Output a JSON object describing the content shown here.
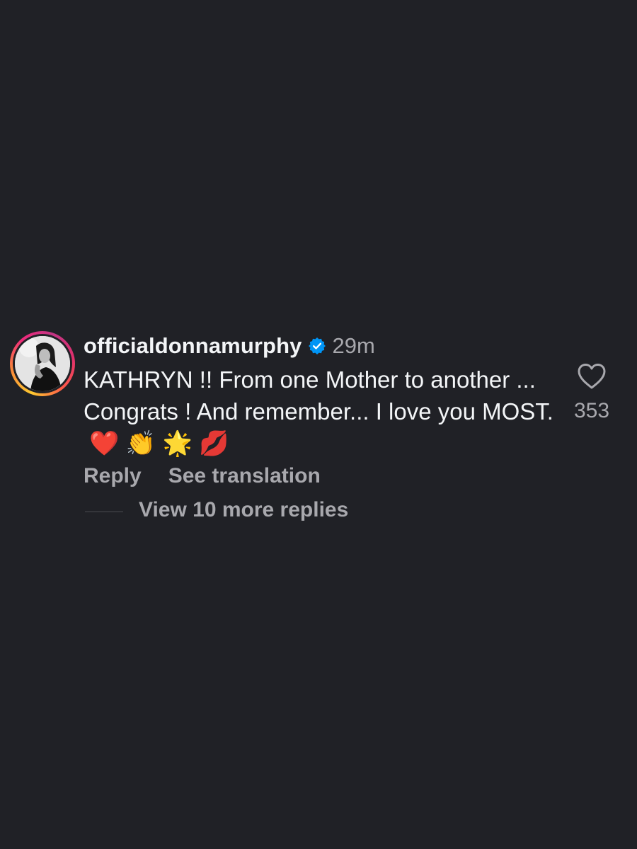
{
  "comment": {
    "username": "officialdonnamurphy",
    "verified_icon": "verified-badge-icon",
    "timestamp": "29m",
    "text": "KATHRYN !! From one Mother to another ... Congrats ! And remember... I love you MOST.",
    "emojis": "❤️ 👏 🌟 💋",
    "like_icon": "heart-outline-icon",
    "like_count": "353",
    "actions": {
      "reply_label": "Reply",
      "translate_label": "See translation"
    },
    "view_replies_label": "View 10 more replies"
  },
  "colors": {
    "background": "#202126",
    "primary_text": "#f3f5f7",
    "secondary_text": "#a8a8ad",
    "verified_blue": "#0095f6"
  }
}
